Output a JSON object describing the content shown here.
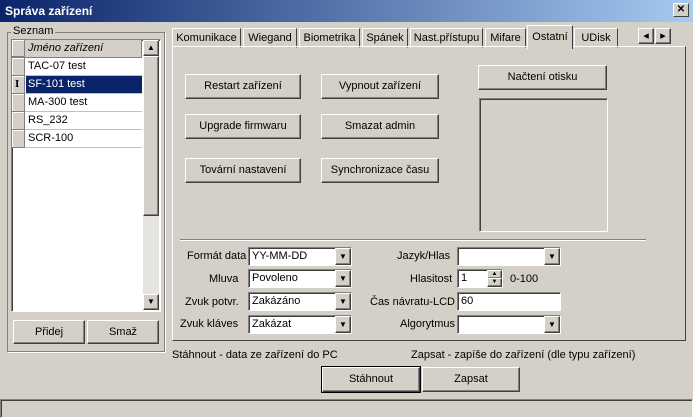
{
  "window": {
    "title": "Správa zařízení",
    "close": "✕"
  },
  "devices": {
    "group_label": "Seznam",
    "column_header": "Jméno zařízení",
    "items": [
      "TAC-07 test",
      "SF-101 test",
      "MA-300 test",
      "RS_232",
      "SCR-100"
    ],
    "selected_index": 1,
    "cursor_marker": "I",
    "add_button": "Přidej",
    "delete_button": "Smaž"
  },
  "tabs": {
    "items": [
      "Komunikace",
      "Wiegand",
      "Biometrika",
      "Spánek",
      "Nast.přístupu",
      "Mifare",
      "Ostatní",
      "UDisk"
    ],
    "active": "Ostatní",
    "scroll_left": "◂",
    "scroll_right": "▸"
  },
  "actions": {
    "restart": "Restart zařízení",
    "shutdown": "Vypnout zařízení",
    "upgrade": "Upgrade firmwaru",
    "clear_admin": "Smazat admin",
    "factory": "Tovární nastavení",
    "sync_time": "Synchronizace času",
    "load_fingerprint": "Načtení otisku"
  },
  "settings": {
    "date_format": {
      "label": "Formát data",
      "value": "YY-MM-DD"
    },
    "speech": {
      "label": "Mluva",
      "value": "Povoleno"
    },
    "confirm_sound": {
      "label": "Zvuk potvr.",
      "value": "Zakázáno"
    },
    "key_sound": {
      "label": "Zvuk kláves",
      "value": "Zakázat"
    },
    "language": {
      "label": "Jazyk/Hlas",
      "value": ""
    },
    "volume": {
      "label": "Hlasitost",
      "value": "1",
      "range": "0-100"
    },
    "lcd_return": {
      "label": "Čas návratu-LCD",
      "value": "60"
    },
    "algorithm": {
      "label": "Algorytmus",
      "value": ""
    }
  },
  "footer": {
    "download_hint": "Stáhnout - data ze zařízení do PC",
    "upload_hint": "Zapsat - zapíše do zařízení (dle typu zařízení)",
    "download_button": "Stáhnout",
    "upload_button": "Zapsat"
  },
  "icons": {
    "dropdown": "▼",
    "scroll_up": "▲",
    "scroll_down": "▼",
    "spin_up": "▲",
    "spin_down": "▼"
  }
}
